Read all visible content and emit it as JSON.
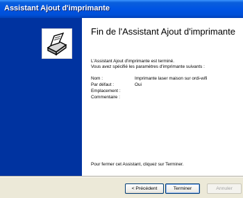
{
  "window": {
    "title": "Assistant Ajout d'imprimante"
  },
  "sidebar": {
    "graphic": "printer-icon"
  },
  "page": {
    "heading": "Fin de l'Assistant Ajout d'imprimante",
    "intro_line1": "L'Assistant Ajout d'imprimante est terminé.",
    "intro_line2": "Vous avez spécifié les paramètres d'imprimante suivants :",
    "fields": [
      {
        "label": "Nom :",
        "value": "Imprimante laser maison sur ordi-wifi"
      },
      {
        "label": "Par défaut :",
        "value": "Oui"
      },
      {
        "label": "Emplacement :",
        "value": ""
      },
      {
        "label": "Commentaire :",
        "value": ""
      }
    ],
    "closing": "Pour fermer cet Assistant, cliquez sur Terminer."
  },
  "buttons": {
    "back": "< Précédent",
    "finish": "Terminer",
    "cancel": "Annuler"
  },
  "colors": {
    "titlebar": "#0054e3",
    "sidebar": "#0033a0",
    "window_face": "#ece9d8"
  }
}
